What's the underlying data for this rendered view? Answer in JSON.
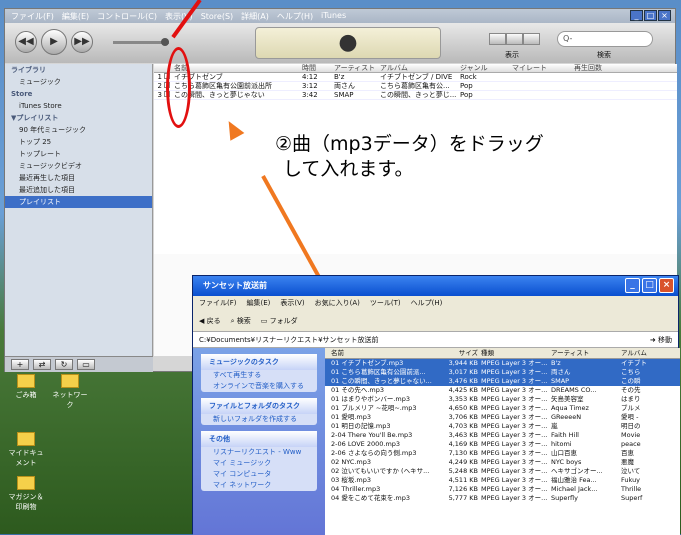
{
  "itunes": {
    "window_title": "iTunes",
    "menu": [
      "ファイル(F)",
      "編集(E)",
      "コントロール(C)",
      "表示(V)",
      "Store(S)",
      "詳細(A)",
      "ヘルプ(H)"
    ],
    "view_label": "表示",
    "search_placeholder": "Q-",
    "search_label": "検索",
    "sidebar": [
      {
        "label": "ライブラリ",
        "type": "hdr"
      },
      {
        "label": "ミュージック",
        "type": "ind"
      },
      {
        "label": "Store",
        "type": "hdr"
      },
      {
        "label": "iTunes Store",
        "type": "ind"
      },
      {
        "label": "▼プレイリスト",
        "type": "hdr"
      },
      {
        "label": "90 年代ミュージック",
        "type": "ind"
      },
      {
        "label": "トップ 25",
        "type": "ind"
      },
      {
        "label": "トップレート",
        "type": "ind"
      },
      {
        "label": "ミュージックビデオ",
        "type": "ind"
      },
      {
        "label": "最近再生した項目",
        "type": "ind"
      },
      {
        "label": "最近追加した項目",
        "type": "ind"
      },
      {
        "label": "プレイリスト",
        "type": "sel"
      }
    ],
    "columns": [
      "",
      "",
      "名前",
      "時間",
      "アーティスト",
      "アルバム",
      "ジャンル",
      "マイレート",
      "再生回数"
    ],
    "tracks": [
      {
        "n": "1",
        "name": "イチブトゼンブ",
        "time": "4:12",
        "artist": "B'z",
        "album": "イチブトゼンブ / DIVE",
        "genre": "Rock"
      },
      {
        "n": "2",
        "name": "こちら葛飾区亀有公園前派出所",
        "time": "3:12",
        "artist": "両さん",
        "album": "こちら葛飾区亀有公...",
        "genre": "Pop"
      },
      {
        "n": "3",
        "name": "この瞬間、きっと夢じゃない",
        "time": "3:42",
        "artist": "SMAP",
        "album": "この瞬間、きっと夢じ...",
        "genre": "Pop"
      }
    ]
  },
  "annotation": {
    "line1": "②曲（mp3データ）をドラッグ",
    "line2": "して入れます。"
  },
  "desktop_icons": [
    {
      "label": "ごみ箱"
    },
    {
      "label": "ネットワーク"
    },
    {
      "label": "マイドキュメント"
    },
    {
      "label": "マガジン＆印刷物"
    }
  ],
  "explorer": {
    "title": "サンセット放送前",
    "menu": [
      "ファイル(F)",
      "編集(E)",
      "表示(V)",
      "お気に入り(A)",
      "ツール(T)",
      "ヘルプ(H)"
    ],
    "toolbar": [
      "戻る",
      "検索",
      "フォルダ"
    ],
    "address": "C:¥Documents¥リスナーリクエスト¥サンセット放送前",
    "go_label": "移動",
    "tasks_title": "ミュージックのタスク",
    "tasks": [
      "すべて再生する",
      "オンラインで音楽を購入する"
    ],
    "file_tasks_title": "ファイルとフォルダのタスク",
    "file_tasks": [
      "新しいフォルダを作成する"
    ],
    "other_title": "その他",
    "other": [
      "リスナーリクエスト - Www",
      "マイ ミュージック",
      "マイ コンピュータ",
      "マイ ネットワーク"
    ],
    "columns": [
      "名前",
      "サイズ",
      "種類",
      "アーティスト",
      "アルバム"
    ],
    "files": [
      {
        "name": "01 イチブトゼンブ.mp3",
        "size": "3,944 KB",
        "type": "MPEG Layer 3 オー...",
        "artist": "B'z",
        "album": "イチブト"
      },
      {
        "name": "01 こちら葛飾区亀有公園前派...",
        "size": "3,017 KB",
        "type": "MPEG Layer 3 オー...",
        "artist": "両さん",
        "album": "こちら"
      },
      {
        "name": "01 この瞬間、きっと夢じゃない...",
        "size": "3,476 KB",
        "type": "MPEG Layer 3 オー...",
        "artist": "SMAP",
        "album": "この瞬"
      },
      {
        "name": "01 その先へ.mp3",
        "size": "4,425 KB",
        "type": "MPEG Layer 3 オー...",
        "artist": "DREAMS CO...",
        "album": "その先"
      },
      {
        "name": "01 はまりやボンバー.mp3",
        "size": "3,353 KB",
        "type": "MPEG Layer 3 オー...",
        "artist": "矢島美容室",
        "album": "はまり"
      },
      {
        "name": "01 ブルメリア ~花唄~.mp3",
        "size": "4,650 KB",
        "type": "MPEG Layer 3 オー...",
        "artist": "Aqua Timez",
        "album": "ブルメ"
      },
      {
        "name": "01 愛唄.mp3",
        "size": "3,706 KB",
        "type": "MPEG Layer 3 オー...",
        "artist": "GReeeeN",
        "album": "愛唄 -"
      },
      {
        "name": "01 明日の記憶.mp3",
        "size": "4,703 KB",
        "type": "MPEG Layer 3 オー...",
        "artist": "嵐",
        "album": "明日の"
      },
      {
        "name": "2-04 There You'll Be.mp3",
        "size": "3,463 KB",
        "type": "MPEG Layer 3 オー...",
        "artist": "Faith Hill",
        "album": "Movie"
      },
      {
        "name": "2-06 LOVE 2000.mp3",
        "size": "4,169 KB",
        "type": "MPEG Layer 3 オー...",
        "artist": "hitomi",
        "album": "peace"
      },
      {
        "name": "2-06 さよならの向う側.mp3",
        "size": "7,130 KB",
        "type": "MPEG Layer 3 オー...",
        "artist": "山口百恵",
        "album": "百恵"
      },
      {
        "name": "02 NYC.mp3",
        "size": "4,249 KB",
        "type": "MPEG Layer 3 オー...",
        "artist": "NYC boys",
        "album": "悪魔"
      },
      {
        "name": "02 泣いてもいいですか (ヘキサ...",
        "size": "5,248 KB",
        "type": "MPEG Layer 3 オー...",
        "artist": "ヘキサゴンオー...",
        "album": "泣いて"
      },
      {
        "name": "03 桜坂.mp3",
        "size": "4,511 KB",
        "type": "MPEG Layer 3 オー...",
        "artist": "福山雅治 Fea...",
        "album": "Fukuy"
      },
      {
        "name": "04 Thriller.mp3",
        "size": "7,126 KB",
        "type": "MPEG Layer 3 オー...",
        "artist": "Michael Jack...",
        "album": "Thrille"
      },
      {
        "name": "04 愛をこめて花束を.mp3",
        "size": "5,777 KB",
        "type": "MPEG Layer 3 オー...",
        "artist": "Superfly",
        "album": "Superf"
      }
    ]
  }
}
